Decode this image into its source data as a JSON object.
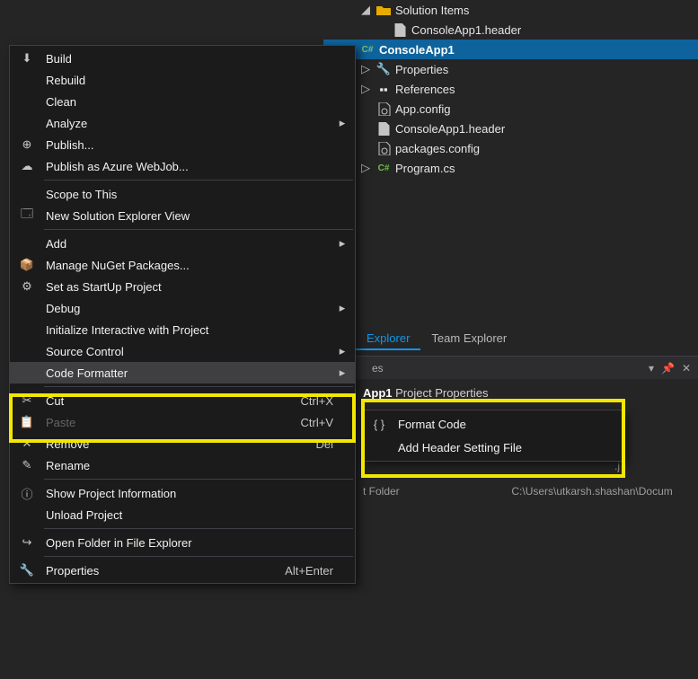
{
  "tree": {
    "solutionItems": "Solution Items",
    "header1": "ConsoleApp1.header",
    "project": "ConsoleApp1",
    "properties": "Properties",
    "references": "References",
    "appConfig": "App.config",
    "header2": "ConsoleApp1.header",
    "packages": "packages.config",
    "program": "Program.cs"
  },
  "tabs": {
    "explorer": "Explorer",
    "teamExplorer": "Team Explorer"
  },
  "propHeader": {
    "es": "es"
  },
  "propTitle": {
    "name": "App1",
    "rest": "Project Properties"
  },
  "propGrid": {
    "folderLabel": "t Folder",
    "folderValue": "C:\\Users\\utkarsh.shashan\\Docum"
  },
  "menu": [
    {
      "t": "item",
      "icon": "build-icon",
      "label": "Build"
    },
    {
      "t": "item",
      "icon": "",
      "label": "Rebuild"
    },
    {
      "t": "item",
      "icon": "",
      "label": "Clean"
    },
    {
      "t": "item",
      "icon": "",
      "label": "Analyze",
      "sub": true
    },
    {
      "t": "item",
      "icon": "publish-icon",
      "label": "Publish..."
    },
    {
      "t": "item",
      "icon": "cloud-icon",
      "label": "Publish as Azure WebJob..."
    },
    {
      "t": "sep"
    },
    {
      "t": "item",
      "icon": "",
      "label": "Scope to This"
    },
    {
      "t": "item",
      "icon": "explorer-icon",
      "label": "New Solution Explorer View"
    },
    {
      "t": "sep"
    },
    {
      "t": "item",
      "icon": "",
      "label": "Add",
      "sub": true
    },
    {
      "t": "item",
      "icon": "nuget-icon",
      "label": "Manage NuGet Packages..."
    },
    {
      "t": "item",
      "icon": "gear-icon",
      "label": "Set as StartUp Project"
    },
    {
      "t": "item",
      "icon": "",
      "label": "Debug",
      "sub": true
    },
    {
      "t": "item",
      "icon": "",
      "label": "Initialize Interactive with Project"
    },
    {
      "t": "item",
      "icon": "",
      "label": "Source Control",
      "sub": true
    },
    {
      "t": "item",
      "icon": "",
      "label": "Code Formatter",
      "sub": true,
      "hovered": true
    },
    {
      "t": "sep"
    },
    {
      "t": "item",
      "icon": "cut-icon",
      "label": "Cut",
      "shortcut": "Ctrl+X"
    },
    {
      "t": "item",
      "icon": "paste-icon",
      "label": "Paste",
      "shortcut": "Ctrl+V",
      "disabled": true
    },
    {
      "t": "item",
      "icon": "remove-icon",
      "label": "Remove",
      "shortcut": "Del"
    },
    {
      "t": "item",
      "icon": "rename-icon",
      "label": "Rename"
    },
    {
      "t": "sep"
    },
    {
      "t": "item",
      "icon": "info-icon",
      "label": "Show Project Information"
    },
    {
      "t": "item",
      "icon": "",
      "label": "Unload Project"
    },
    {
      "t": "sep"
    },
    {
      "t": "item",
      "icon": "open-folder-icon",
      "label": "Open Folder in File Explorer"
    },
    {
      "t": "sep"
    },
    {
      "t": "item",
      "icon": "wrench-icon",
      "label": "Properties",
      "shortcut": "Alt+Enter"
    }
  ],
  "submenu": [
    {
      "icon": "format-code-icon",
      "label": "Format Code"
    },
    {
      "icon": "",
      "label": "Add Header Setting File"
    }
  ],
  "proj_ext": ".j"
}
